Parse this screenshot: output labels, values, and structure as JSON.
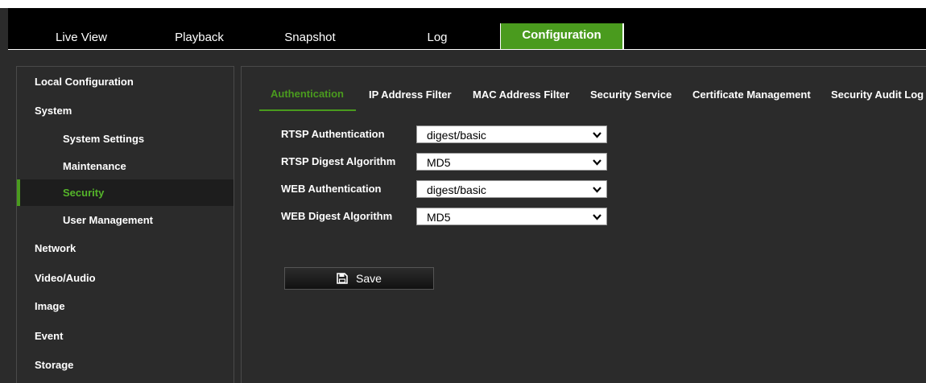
{
  "nav": {
    "tabs": [
      {
        "label": "Live View"
      },
      {
        "label": "Playback"
      },
      {
        "label": "Snapshot"
      },
      {
        "label": "Log"
      },
      {
        "label": "Configuration"
      }
    ],
    "active": "Configuration"
  },
  "sidebar": {
    "items": [
      {
        "label": "Local Configuration"
      },
      {
        "label": "System"
      },
      {
        "label": "System Settings"
      },
      {
        "label": "Maintenance"
      },
      {
        "label": "Security"
      },
      {
        "label": "User Management"
      },
      {
        "label": "Network"
      },
      {
        "label": "Video/Audio"
      },
      {
        "label": "Image"
      },
      {
        "label": "Event"
      },
      {
        "label": "Storage"
      }
    ],
    "active": "Security"
  },
  "content": {
    "tabs": [
      {
        "label": "Authentication"
      },
      {
        "label": "IP Address Filter"
      },
      {
        "label": "MAC Address Filter"
      },
      {
        "label": "Security Service"
      },
      {
        "label": "Certificate Management"
      },
      {
        "label": "Security Audit Log"
      }
    ],
    "active_tab": "Authentication",
    "form": [
      {
        "label": "RTSP Authentication",
        "value": "digest/basic"
      },
      {
        "label": "RTSP Digest Algorithm",
        "value": "MD5"
      },
      {
        "label": "WEB Authentication",
        "value": "digest/basic"
      },
      {
        "label": "WEB Digest Algorithm",
        "value": "MD5"
      }
    ],
    "save_label": "Save"
  },
  "colors": {
    "accent": "#4a9b1e",
    "background": "#2b2b2b",
    "navbar": "#000000"
  }
}
